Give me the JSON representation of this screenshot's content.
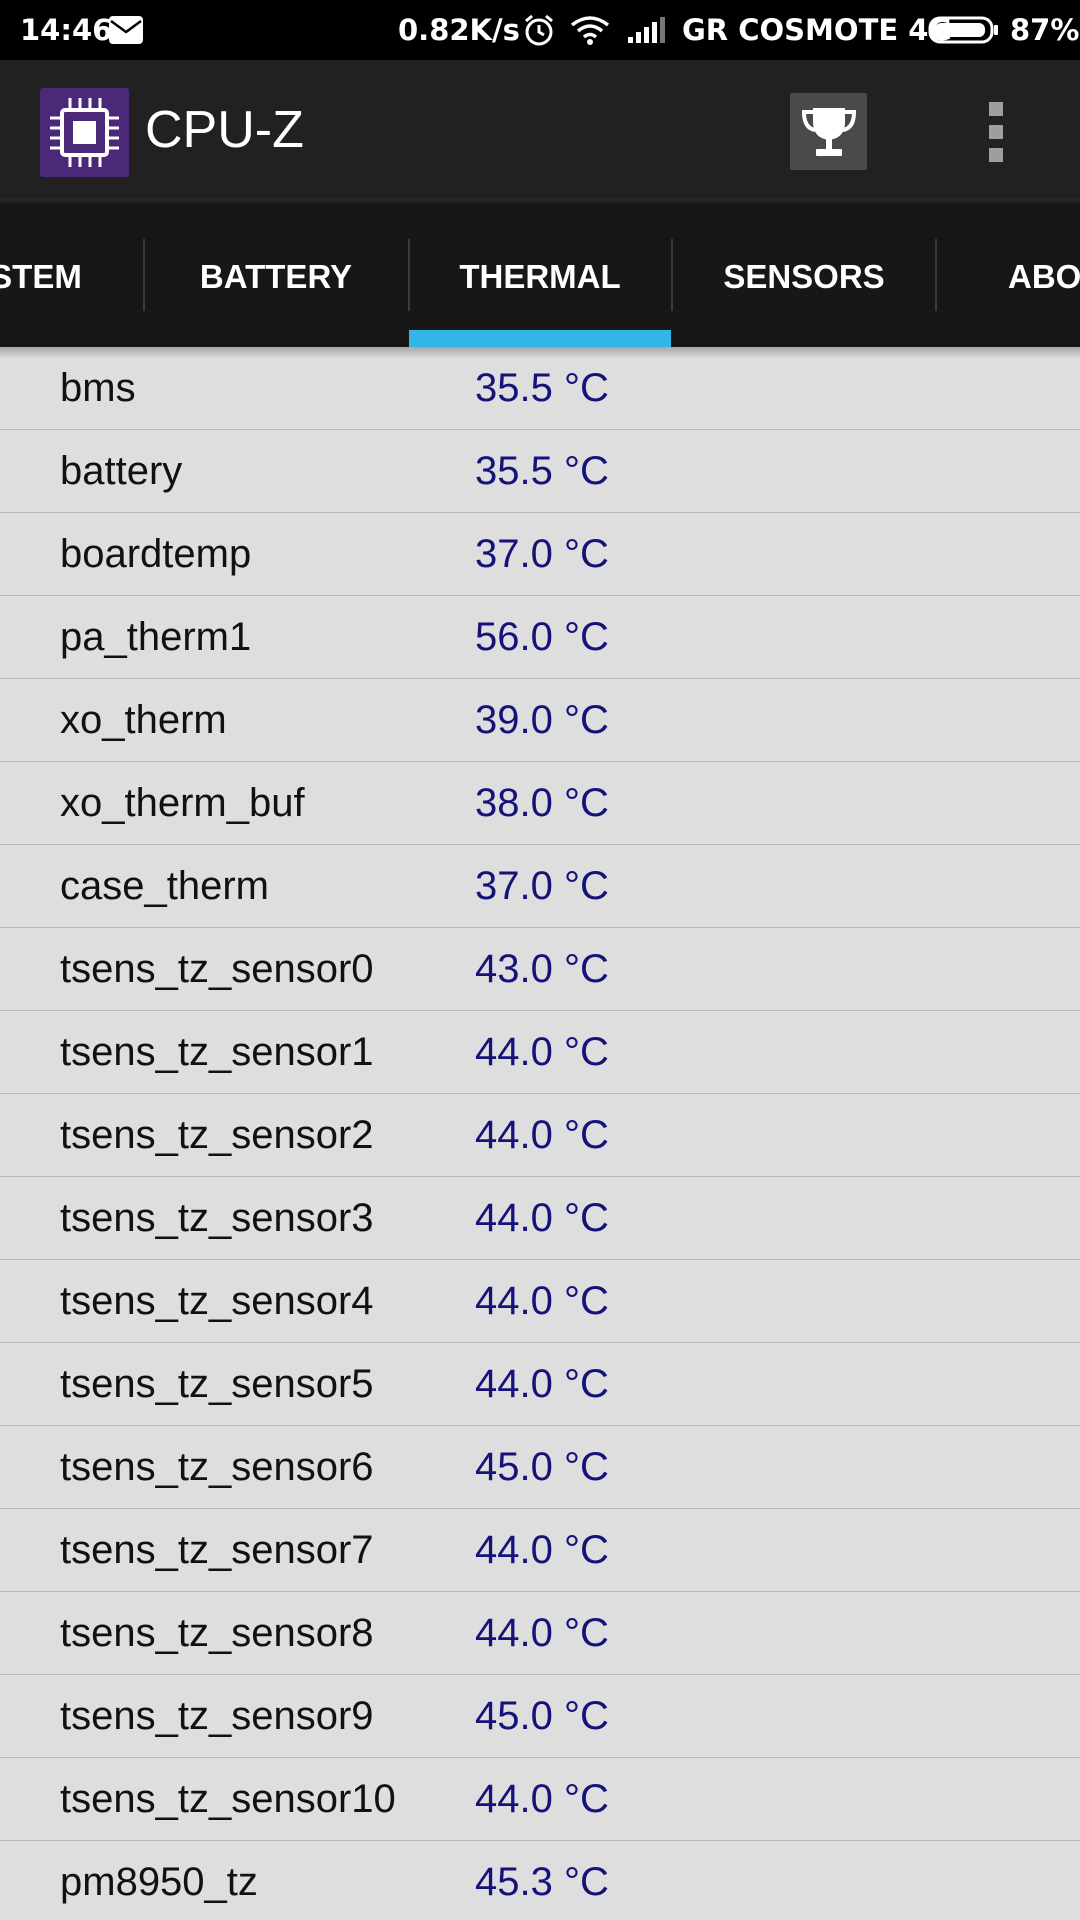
{
  "status_bar": {
    "time": "14:46",
    "net_speed": "0.82K/s",
    "carrier": "GR COSMOTE 4G",
    "battery_percent": "87%",
    "icons": [
      "mail-icon",
      "alarm-icon",
      "wifi-icon",
      "signal-icon",
      "battery-icon"
    ]
  },
  "app_bar": {
    "title": "CPU-Z",
    "icons": [
      "app-logo-icon",
      "trophy-icon",
      "overflow-menu-icon"
    ]
  },
  "tabs": [
    {
      "label": "STEM",
      "selected": false
    },
    {
      "label": "BATTERY",
      "selected": false
    },
    {
      "label": "THERMAL",
      "selected": true
    },
    {
      "label": "SENSORS",
      "selected": false
    },
    {
      "label": "ABO",
      "selected": false
    }
  ],
  "thermal": {
    "rows": [
      {
        "name": "bms",
        "value": "35.5 °C"
      },
      {
        "name": "battery",
        "value": "35.5 °C"
      },
      {
        "name": "boardtemp",
        "value": "37.0 °C"
      },
      {
        "name": "pa_therm1",
        "value": "56.0 °C"
      },
      {
        "name": "xo_therm",
        "value": "39.0 °C"
      },
      {
        "name": "xo_therm_buf",
        "value": "38.0 °C"
      },
      {
        "name": "case_therm",
        "value": "37.0 °C"
      },
      {
        "name": "tsens_tz_sensor0",
        "value": "43.0 °C"
      },
      {
        "name": "tsens_tz_sensor1",
        "value": "44.0 °C"
      },
      {
        "name": "tsens_tz_sensor2",
        "value": "44.0 °C"
      },
      {
        "name": "tsens_tz_sensor3",
        "value": "44.0 °C"
      },
      {
        "name": "tsens_tz_sensor4",
        "value": "44.0 °C"
      },
      {
        "name": "tsens_tz_sensor5",
        "value": "44.0 °C"
      },
      {
        "name": "tsens_tz_sensor6",
        "value": "45.0 °C"
      },
      {
        "name": "tsens_tz_sensor7",
        "value": "44.0 °C"
      },
      {
        "name": "tsens_tz_sensor8",
        "value": "44.0 °C"
      },
      {
        "name": "tsens_tz_sensor9",
        "value": "45.0 °C"
      },
      {
        "name": "tsens_tz_sensor10",
        "value": "44.0 °C"
      },
      {
        "name": "pm8950_tz",
        "value": "45.3 °C"
      }
    ]
  },
  "colors": {
    "tab_indicator": "#33b5e5",
    "value_text": "#15137a",
    "app_bar": "#212121",
    "list_background": "#dedede"
  }
}
